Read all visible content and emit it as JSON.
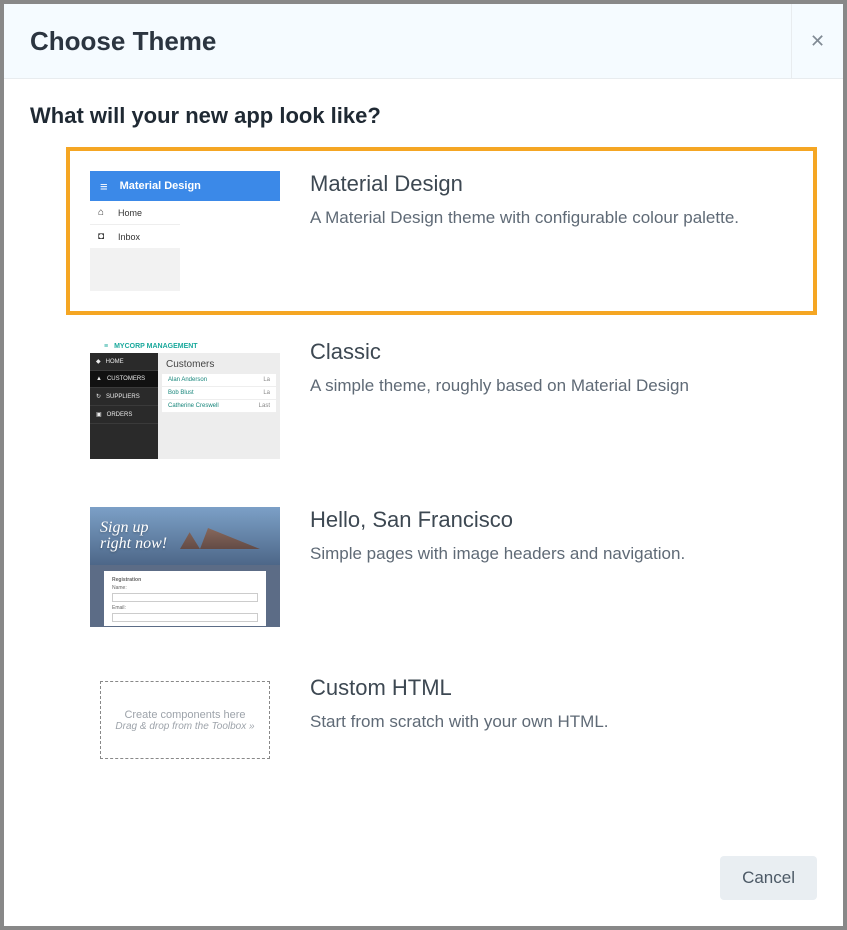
{
  "modal": {
    "title": "Choose Theme",
    "subtitle": "What will your new app look like?"
  },
  "themes": [
    {
      "title": "Material Design",
      "desc": "A Material Design theme with configurable colour palette.",
      "selected": true,
      "preview": {
        "topbar_title": "Material Design",
        "items": [
          "Home",
          "Inbox"
        ]
      }
    },
    {
      "title": "Classic",
      "desc": "A simple theme, roughly based on Material Design",
      "selected": false,
      "preview": {
        "brand": "MYCORP MANAGEMENT",
        "side_items": [
          "HOME",
          "CUSTOMERS",
          "SUPPLIERS",
          "ORDERS"
        ],
        "main_title": "Customers",
        "rows": [
          {
            "name": "Alan Anderson",
            "right": "La"
          },
          {
            "name": "Bob Blust",
            "right": "La"
          },
          {
            "name": "Catherine Creswell",
            "right": "Last"
          }
        ]
      }
    },
    {
      "title": "Hello, San Francisco",
      "desc": "Simple pages with image headers and navigation.",
      "selected": false,
      "preview": {
        "headline": "Sign up\nright now!",
        "form_labels": [
          "Registration",
          "Name:",
          "Email:"
        ]
      }
    },
    {
      "title": "Custom HTML",
      "desc": "Start from scratch with your own HTML.",
      "selected": false,
      "preview": {
        "line1": "Create components here",
        "line2": "Drag & drop from the Toolbox »"
      }
    }
  ],
  "footer": {
    "cancel": "Cancel"
  }
}
